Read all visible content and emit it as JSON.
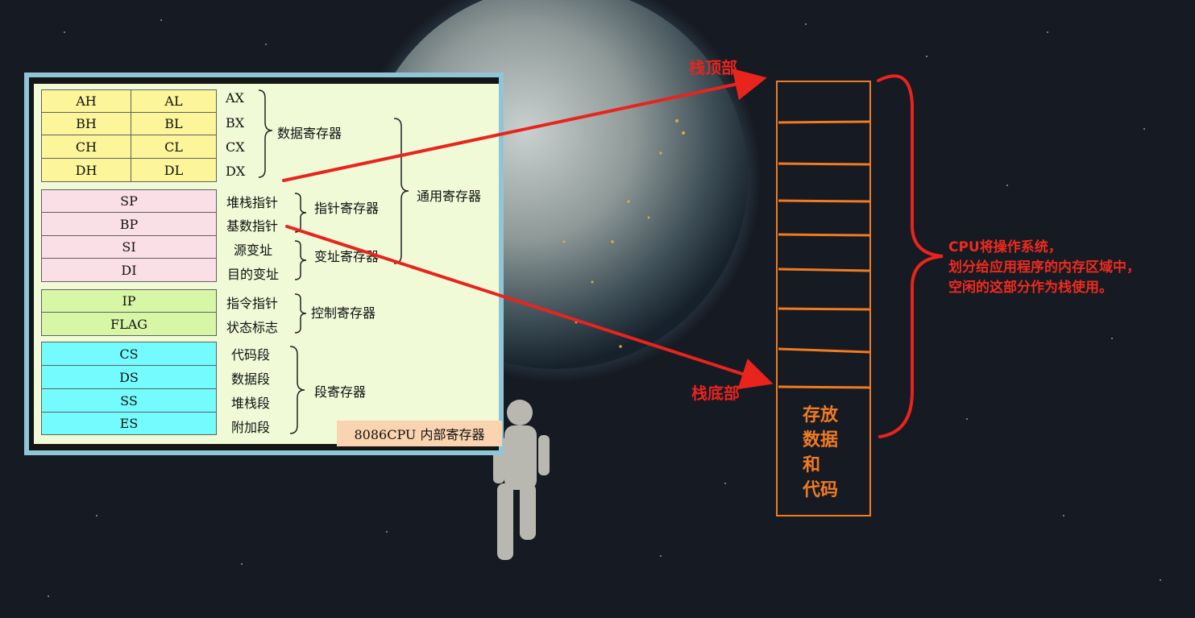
{
  "registers": {
    "data_rows": [
      {
        "high": "AH",
        "low": "AL",
        "name": "AX"
      },
      {
        "high": "BH",
        "low": "BL",
        "name": "BX"
      },
      {
        "high": "CH",
        "low": "CL",
        "name": "CX"
      },
      {
        "high": "DH",
        "low": "DL",
        "name": "DX"
      }
    ],
    "data_group": "数据寄存器",
    "pointer_rows": [
      {
        "reg": "SP",
        "desc": "堆栈指针"
      },
      {
        "reg": "BP",
        "desc": "基数指针"
      }
    ],
    "pointer_group": "指针寄存器",
    "index_rows": [
      {
        "reg": "SI",
        "desc": "源变址"
      },
      {
        "reg": "DI",
        "desc": "目的变址"
      }
    ],
    "index_group": "变址寄存器",
    "general_group": "通用寄存器",
    "control_rows": [
      {
        "reg": "IP",
        "desc": "指令指针"
      },
      {
        "reg": "FLAG",
        "desc": "状态标志"
      }
    ],
    "control_group": "控制寄存器",
    "segment_rows": [
      {
        "reg": "CS",
        "desc": "代码段"
      },
      {
        "reg": "DS",
        "desc": "数据段"
      },
      {
        "reg": "SS",
        "desc": "堆栈段"
      },
      {
        "reg": "ES",
        "desc": "附加段"
      }
    ],
    "segment_group": "段寄存器",
    "caption": "8086CPU 内部寄存器"
  },
  "stack": {
    "top_label": "栈顶部",
    "bottom_label": "栈底部",
    "data_lines": [
      "存放",
      "数据",
      "和",
      "代码"
    ],
    "note_lines": [
      "CPU将操作系统，",
      "划分给应用程序的内存区域中，",
      "空闲的这部分作为栈使用。"
    ]
  },
  "colors": {
    "arrow_red": "#e8241d",
    "stack_orange": "#f07b22",
    "data_reg": "#fdf599",
    "pointer_reg": "#fbdfe6",
    "control_reg": "#d8f7a6",
    "segment_reg": "#73fbfd",
    "caption_bg": "#fad3b0"
  }
}
